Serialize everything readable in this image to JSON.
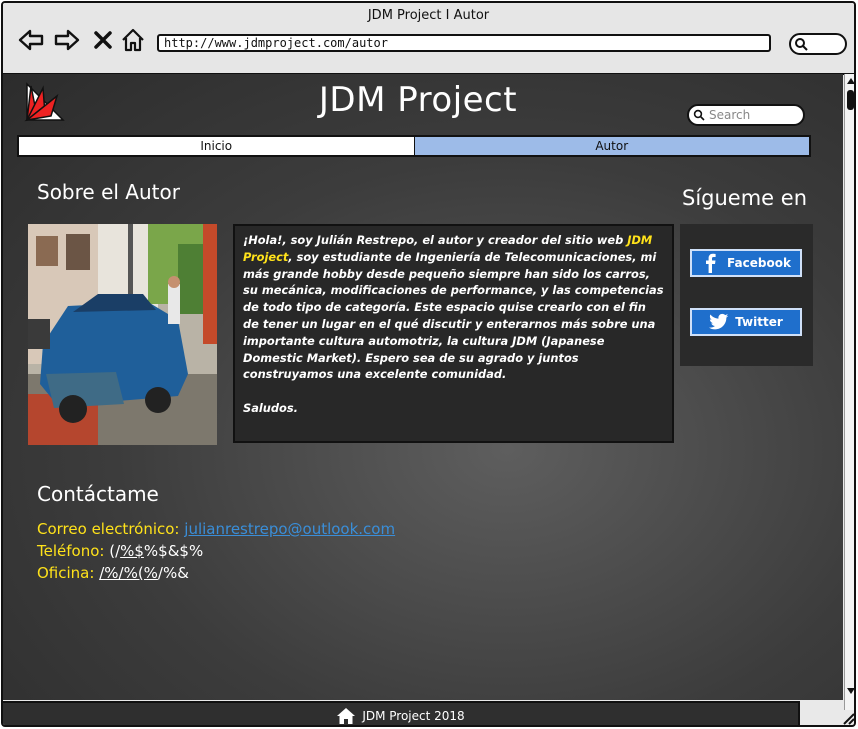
{
  "window": {
    "title": "JDM Project I Autor",
    "url": "http://www.jdmproject.com/autor"
  },
  "header": {
    "brand": "JDM Project",
    "search_placeholder": "Search"
  },
  "tabs": [
    {
      "label": "Inicio",
      "active": false
    },
    {
      "label": "Autor",
      "active": true
    }
  ],
  "about": {
    "heading": "Sobre el Autor",
    "photo_alt": "Foto del autor con un carro azul",
    "bio_part1": "¡Hola!, soy Julián Restrepo, el autor y creador del sitio web ",
    "bio_highlight": "JDM Project",
    "bio_part2": ", soy estudiante de Ingeniería de Telecomunicaciones, mi más grande hobby desde pequeño siempre han sido los carros, su mecánica, modificaciones de performance, y las competencias de todo tipo de categoría. Este espacio quise crearlo con el fin de tener un lugar en el qué discutir y enterarnos más sobre una importante cultura automotriz, la cultura JDM (Japanese Domestic Market). Espero sea de su agrado y juntos construyamos una excelente comunidad.",
    "bio_closing": "Saludos."
  },
  "follow": {
    "heading": "Sígueme en",
    "facebook_label": "Facebook",
    "twitter_label": "Twitter"
  },
  "contact": {
    "heading": "Contáctame",
    "email_label": "Correo electrónico:",
    "email_value": "julianrestrepo@outlook.com",
    "phone_label": "Teléfono:",
    "phone_value_pre": "(/",
    "phone_value_u": "%$",
    "phone_value_post": "%$&$%",
    "office_label": "Oficina:",
    "office_value_u": "/%/%(%",
    "office_value_post": "/%&"
  },
  "footer": {
    "text": "JDM Project 2018"
  },
  "colors": {
    "accent_yellow": "#ffe21a",
    "tab_active": "#9dbbe8",
    "link_blue": "#3a8ed8",
    "social_blue": "#1f6fcc"
  }
}
